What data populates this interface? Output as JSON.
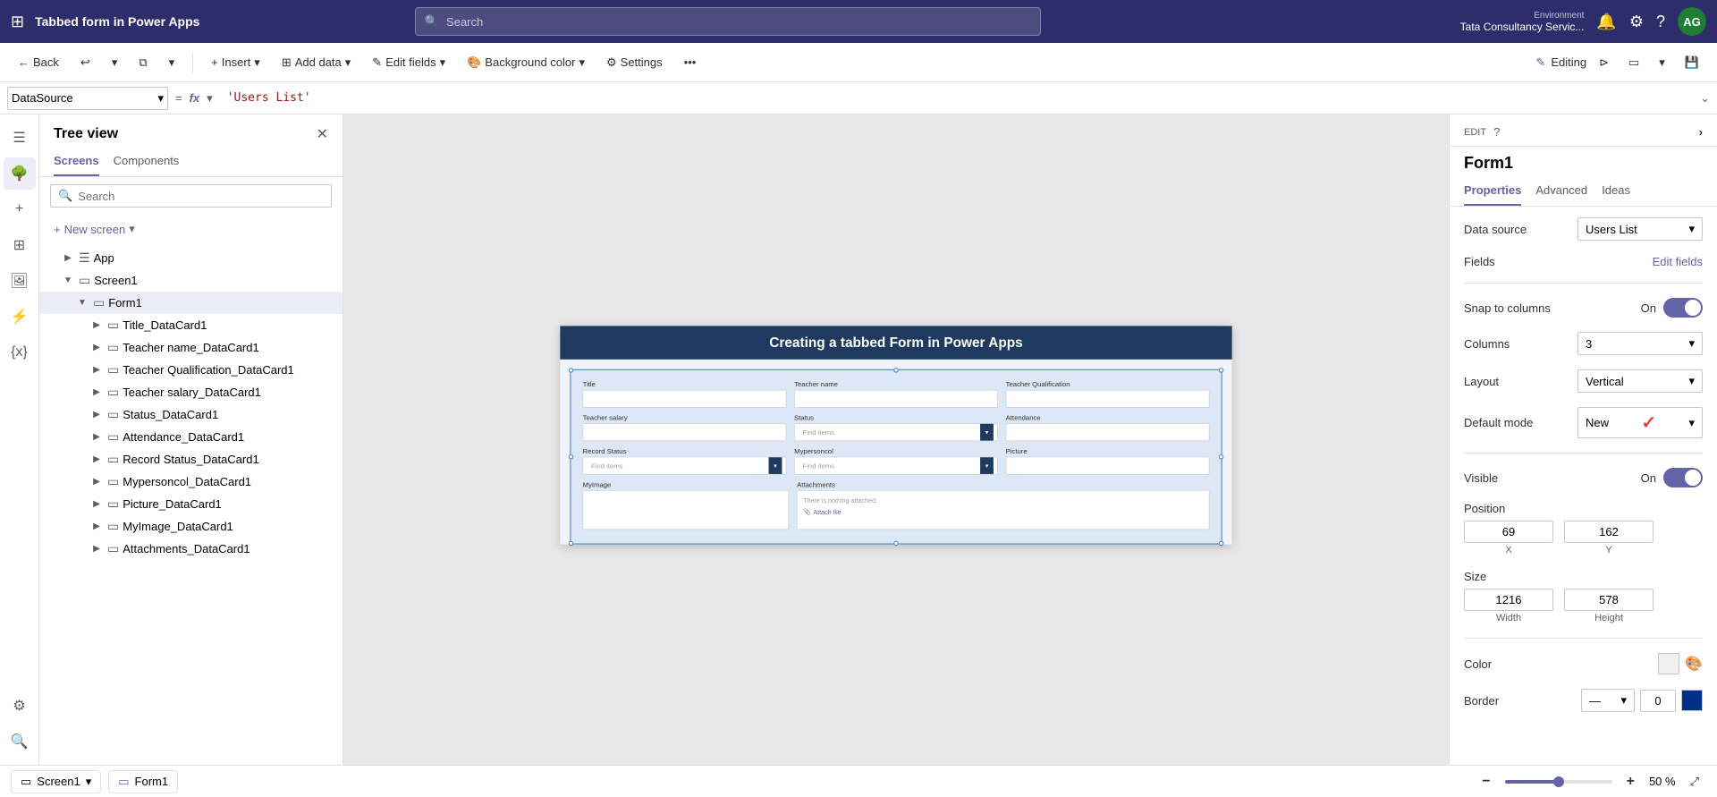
{
  "topNav": {
    "appName": "Power Apps",
    "title": "Tabbed form in Power Apps",
    "searchPlaceholder": "Search",
    "environment": {
      "label": "Environment",
      "name": "Tata Consultancy Servic..."
    },
    "avatar": "AG"
  },
  "toolbar": {
    "backLabel": "Back",
    "insertLabel": "Insert",
    "addDataLabel": "Add data",
    "editFieldsLabel": "Edit fields",
    "backgroundColorLabel": "Background color",
    "settingsLabel": "Settings",
    "editingLabel": "Editing"
  },
  "formulaBar": {
    "datasource": "DataSource",
    "fx": "fx",
    "formula": "'Users List'"
  },
  "treeView": {
    "title": "Tree view",
    "tabs": [
      "Screens",
      "Components"
    ],
    "activeTab": "Screens",
    "searchPlaceholder": "Search",
    "newScreenLabel": "New screen",
    "items": [
      {
        "label": "App",
        "level": 1,
        "icon": "☰",
        "expanded": false
      },
      {
        "label": "Screen1",
        "level": 1,
        "icon": "▭",
        "expanded": true
      },
      {
        "label": "Form1",
        "level": 2,
        "icon": "▭",
        "expanded": true,
        "selected": true
      },
      {
        "label": "Title_DataCard1",
        "level": 3,
        "icon": "▭"
      },
      {
        "label": "Teacher name_DataCard1",
        "level": 3,
        "icon": "▭"
      },
      {
        "label": "Teacher Qualification_DataCard1",
        "level": 3,
        "icon": "▭"
      },
      {
        "label": "Teacher salary_DataCard1",
        "level": 3,
        "icon": "▭"
      },
      {
        "label": "Status_DataCard1",
        "level": 3,
        "icon": "▭"
      },
      {
        "label": "Attendance_DataCard1",
        "level": 3,
        "icon": "▭"
      },
      {
        "label": "Record Status_DataCard1",
        "level": 3,
        "icon": "▭"
      },
      {
        "label": "Mypersoncol_DataCard1",
        "level": 3,
        "icon": "▭"
      },
      {
        "label": "Picture_DataCard1",
        "level": 3,
        "icon": "▭"
      },
      {
        "label": "MyImage_DataCard1",
        "level": 3,
        "icon": "▭"
      },
      {
        "label": "Attachments_DataCard1",
        "level": 3,
        "icon": "▭"
      }
    ]
  },
  "canvas": {
    "title": "Creating a tabbed Form in Power Apps",
    "fields": {
      "row1": [
        {
          "label": "Title",
          "type": "input",
          "value": ""
        },
        {
          "label": "Teacher name",
          "type": "input",
          "value": ""
        },
        {
          "label": "Teacher Qualification",
          "type": "input",
          "value": ""
        }
      ],
      "row2": [
        {
          "label": "Teacher salary",
          "type": "input",
          "value": ""
        },
        {
          "label": "Status",
          "type": "dropdown",
          "placeholder": "Find items"
        },
        {
          "label": "Attendance",
          "type": "input",
          "value": ""
        }
      ],
      "row3": [
        {
          "label": "Record Status",
          "type": "dropdown",
          "placeholder": "Find items"
        },
        {
          "label": "Mypersoncol",
          "type": "dropdown",
          "placeholder": "Find items"
        },
        {
          "label": "Picture",
          "type": "input",
          "value": ""
        }
      ],
      "row4": [
        {
          "label": "MyImage",
          "type": "input",
          "value": ""
        },
        {
          "label": "Attachments",
          "type": "attachments",
          "emptyText": "There is nothing attached.",
          "attachLabel": "Attach file"
        }
      ]
    }
  },
  "statusBar": {
    "screen1Label": "Screen1",
    "form1Label": "Form1",
    "zoomMinus": "−",
    "zoomPlus": "+",
    "zoomLevel": "50 %",
    "zoomPercent": 50,
    "fitIcon": "⤢"
  },
  "propsPanel": {
    "editLabel": "EDIT",
    "formName": "Form1",
    "tabs": [
      "Properties",
      "Advanced",
      "Ideas"
    ],
    "activeTab": "Properties",
    "dataSource": {
      "label": "Data source",
      "value": "Users List"
    },
    "fields": {
      "label": "Fields",
      "editLink": "Edit fields"
    },
    "snapToColumns": {
      "label": "Snap to columns",
      "value": "On",
      "enabled": true
    },
    "columns": {
      "label": "Columns",
      "value": "3"
    },
    "layout": {
      "label": "Layout",
      "value": "Vertical"
    },
    "defaultMode": {
      "label": "Default mode",
      "value": "New"
    },
    "visible": {
      "label": "Visible",
      "value": "On",
      "enabled": true
    },
    "position": {
      "label": "Position",
      "x": "69",
      "y": "162",
      "xLabel": "X",
      "yLabel": "Y"
    },
    "size": {
      "label": "Size",
      "width": "1216",
      "height": "578",
      "widthLabel": "Width",
      "heightLabel": "Height"
    },
    "color": {
      "label": "Color"
    },
    "border": {
      "label": "Border",
      "value": "0",
      "colorHex": "#003087"
    }
  }
}
